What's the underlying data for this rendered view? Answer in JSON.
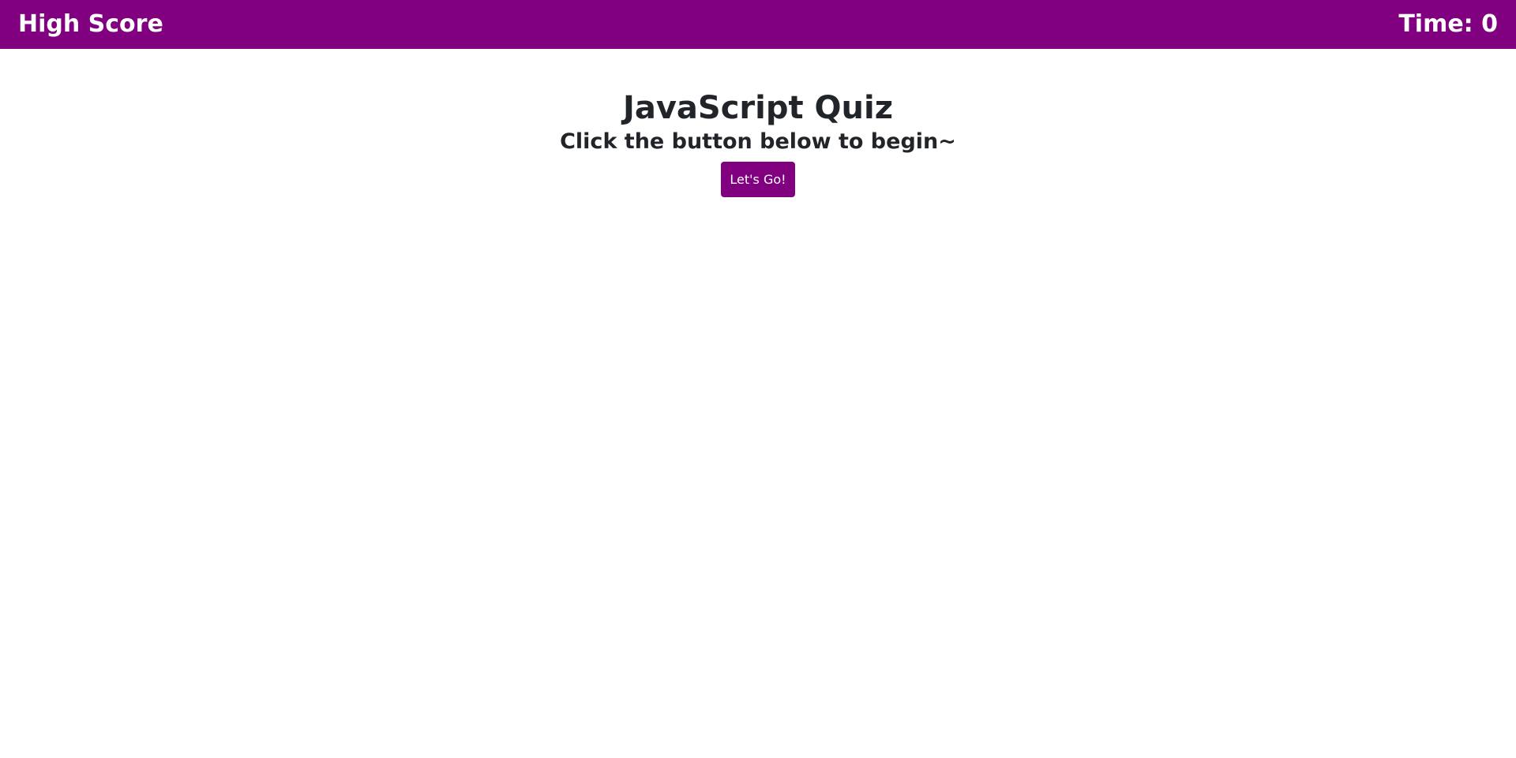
{
  "header": {
    "high_score_link": "High Score",
    "timer": "Time: 0",
    "background_color": "#800080"
  },
  "main": {
    "title": "JavaScript Quiz",
    "subtitle": "Click the button below to begin~",
    "start_button_label": "Let's Go!"
  },
  "colors": {
    "accent": "#800080",
    "text": "#212529",
    "background": "#ffffff"
  }
}
